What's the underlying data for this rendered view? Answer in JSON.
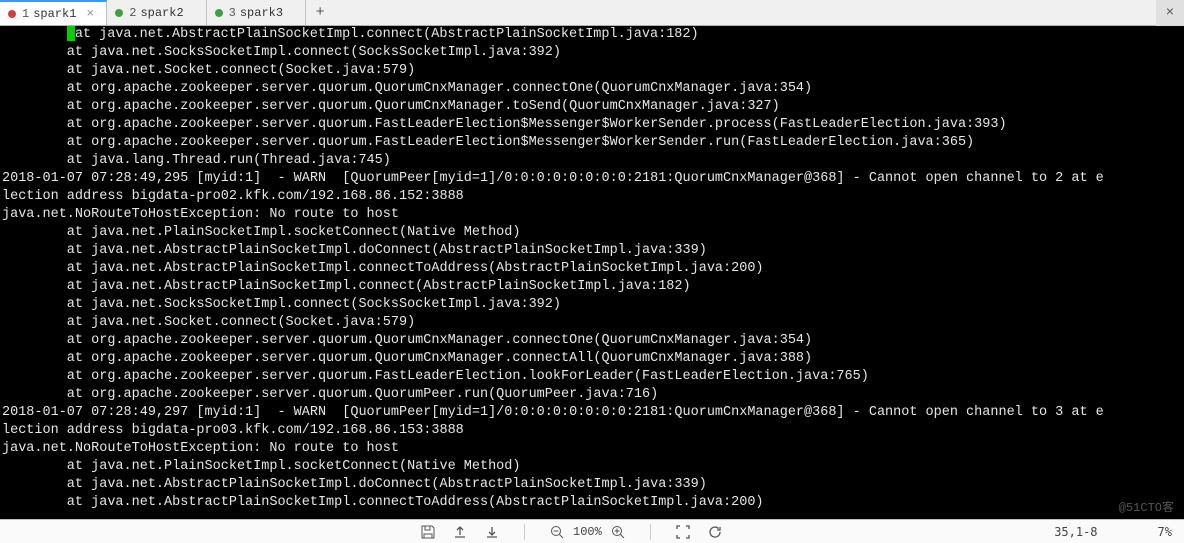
{
  "tabs": [
    {
      "num": "1",
      "name": "spark1",
      "dot": "#d04040",
      "active": true
    },
    {
      "num": "2",
      "name": "spark2",
      "dot": "#40a040",
      "active": false
    },
    {
      "num": "3",
      "name": "spark3",
      "dot": "#40a040",
      "active": false
    }
  ],
  "term_lines": [
    " at java.net.AbstractPlainSocketImpl.connect(AbstractPlainSocketImpl.java:182)",
    "        at java.net.SocksSocketImpl.connect(SocksSocketImpl.java:392)",
    "        at java.net.Socket.connect(Socket.java:579)",
    "        at org.apache.zookeeper.server.quorum.QuorumCnxManager.connectOne(QuorumCnxManager.java:354)",
    "        at org.apache.zookeeper.server.quorum.QuorumCnxManager.toSend(QuorumCnxManager.java:327)",
    "        at org.apache.zookeeper.server.quorum.FastLeaderElection$Messenger$WorkerSender.process(FastLeaderElection.java:393)",
    "        at org.apache.zookeeper.server.quorum.FastLeaderElection$Messenger$WorkerSender.run(FastLeaderElection.java:365)",
    "        at java.lang.Thread.run(Thread.java:745)",
    "2018-01-07 07:28:49,295 [myid:1]  - WARN  [QuorumPeer[myid=1]/0:0:0:0:0:0:0:0:2181:QuorumCnxManager@368] - Cannot open channel to 2 at e",
    "lection address bigdata-pro02.kfk.com/192.168.86.152:3888",
    "java.net.NoRouteToHostException: No route to host",
    "        at java.net.PlainSocketImpl.socketConnect(Native Method)",
    "        at java.net.AbstractPlainSocketImpl.doConnect(AbstractPlainSocketImpl.java:339)",
    "        at java.net.AbstractPlainSocketImpl.connectToAddress(AbstractPlainSocketImpl.java:200)",
    "        at java.net.AbstractPlainSocketImpl.connect(AbstractPlainSocketImpl.java:182)",
    "        at java.net.SocksSocketImpl.connect(SocksSocketImpl.java:392)",
    "        at java.net.Socket.connect(Socket.java:579)",
    "        at org.apache.zookeeper.server.quorum.QuorumCnxManager.connectOne(QuorumCnxManager.java:354)",
    "        at org.apache.zookeeper.server.quorum.QuorumCnxManager.connectAll(QuorumCnxManager.java:388)",
    "        at org.apache.zookeeper.server.quorum.FastLeaderElection.lookForLeader(FastLeaderElection.java:765)",
    "        at org.apache.zookeeper.server.quorum.QuorumPeer.run(QuorumPeer.java:716)",
    "2018-01-07 07:28:49,297 [myid:1]  - WARN  [QuorumPeer[myid=1]/0:0:0:0:0:0:0:0:2181:QuorumCnxManager@368] - Cannot open channel to 3 at e",
    "lection address bigdata-pro03.kfk.com/192.168.86.153:3888",
    "java.net.NoRouteToHostException: No route to host",
    "        at java.net.PlainSocketImpl.socketConnect(Native Method)",
    "        at java.net.AbstractPlainSocketImpl.doConnect(AbstractPlainSocketImpl.java:339)",
    "        at java.net.AbstractPlainSocketImpl.connectToAddress(AbstractPlainSocketImpl.java:200)"
  ],
  "status": {
    "zoom": "100%",
    "pos": "35,1-8",
    "pct": "7%"
  },
  "watermark": "@51CTO客"
}
